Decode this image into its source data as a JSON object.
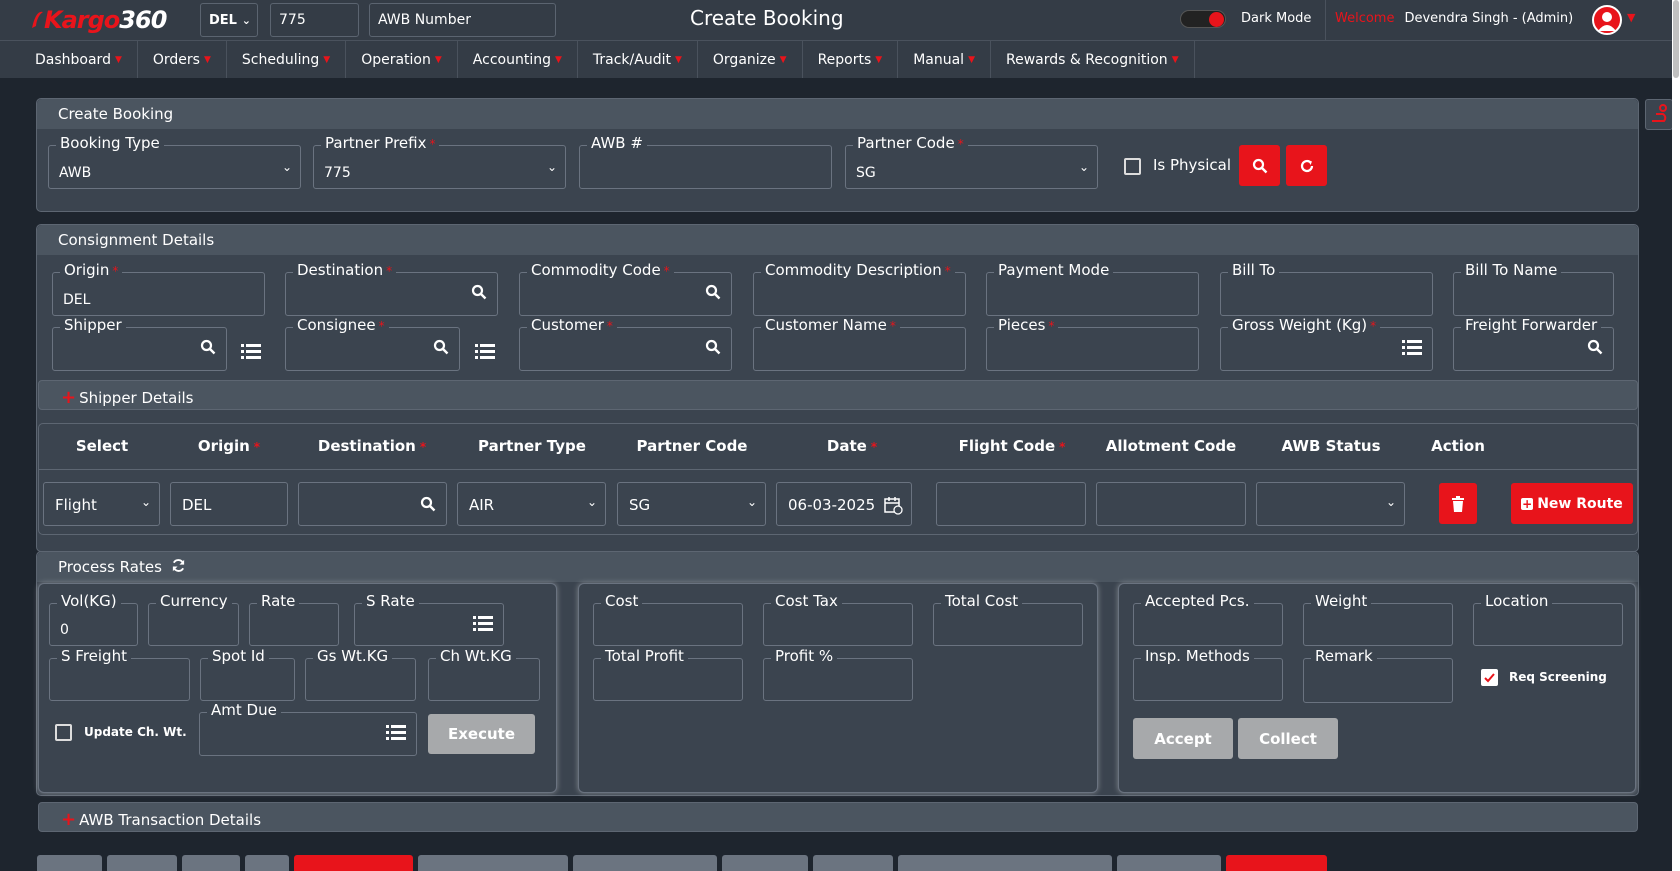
{
  "header": {
    "logo_k": "Kargo",
    "logo_n": "360",
    "station": "DEL",
    "prefix": "775",
    "awb_placeholder": "AWB Number",
    "title": "Create Booking",
    "dark_mode_label": "Dark Mode",
    "welcome_label": "Welcome",
    "user": "Devendra Singh - (Admin)"
  },
  "nav": [
    "Dashboard",
    "Orders",
    "Scheduling",
    "Operation",
    "Accounting",
    "Track/Audit",
    "Organize",
    "Reports",
    "Manual",
    "Rewards & Recognition"
  ],
  "create_booking": {
    "title": "Create Booking",
    "booking_type_label": "Booking Type",
    "booking_type": "AWB",
    "partner_prefix_label": "Partner Prefix",
    "partner_prefix": "775",
    "awb_label": "AWB #",
    "partner_code_label": "Partner Code",
    "partner_code": "SG",
    "is_physical_label": "Is Physical"
  },
  "consignment": {
    "title": "Consignment Details",
    "origin_label": "Origin",
    "origin": "DEL",
    "destination_label": "Destination",
    "commodity_code_label": "Commodity Code",
    "commodity_desc_label": "Commodity Description",
    "payment_mode_label": "Payment Mode",
    "bill_to_label": "Bill To",
    "bill_to_name_label": "Bill To Name",
    "shipper_label": "Shipper",
    "consignee_label": "Consignee",
    "customer_label": "Customer",
    "customer_name_label": "Customer Name",
    "pieces_label": "Pieces",
    "gross_weight_label": "Gross Weight (Kg)",
    "freight_forwarder_label": "Freight Forwarder"
  },
  "shipper_details": "Shipper Details",
  "route": {
    "headers": [
      "Select",
      "Origin",
      "Destination",
      "Partner Type",
      "Partner Code",
      "Date",
      "Flight Code",
      "Allotment Code",
      "AWB Status",
      "Action"
    ],
    "select": "Flight",
    "origin": "DEL",
    "partner_type": "AIR",
    "partner_code": "SG",
    "date": "06-03-2025",
    "new_route": "New Route"
  },
  "rates": {
    "title": "Process Rates",
    "vol_label": "Vol(KG)",
    "vol": "0",
    "currency_label": "Currency",
    "rate_label": "Rate",
    "s_rate_label": "S Rate",
    "s_freight_label": "S Freight",
    "spot_id_label": "Spot Id",
    "gs_wt_label": "Gs Wt.KG",
    "ch_wt_label": "Ch Wt.KG",
    "update_label": "Update Ch. Wt.",
    "amt_due_label": "Amt Due",
    "execute": "Execute",
    "cost_label": "Cost",
    "cost_tax_label": "Cost Tax",
    "total_cost_label": "Total Cost",
    "total_profit_label": "Total Profit",
    "profit_pct_label": "Profit %",
    "accepted_pcs_label": "Accepted Pcs.",
    "weight_label": "Weight",
    "location_label": "Location",
    "insp_label": "Insp. Methods",
    "remark_label": "Remark",
    "req_screening_label": "Req Screening",
    "accept": "Accept",
    "collect": "Collect"
  },
  "awb_transactions": "AWB Transaction Details",
  "colors": {
    "accent": "#e8141b",
    "panel": "#3b444f",
    "background": "#1e252e"
  },
  "icons": [
    "search-icon",
    "list-icon",
    "calendar-icon",
    "trash-icon",
    "refresh-icon",
    "plus-icon",
    "chevron-down-icon",
    "user-icon"
  ]
}
